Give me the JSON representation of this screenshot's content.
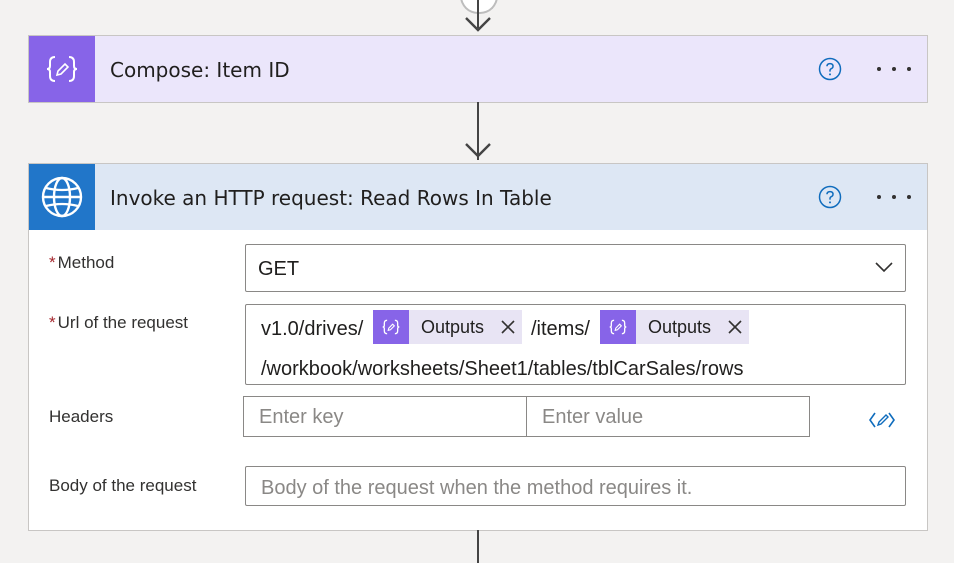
{
  "compose": {
    "title": "Compose: Item ID"
  },
  "http": {
    "title": "Invoke an HTTP request: Read Rows In Table",
    "required_marker": "*",
    "method": {
      "label": "Method",
      "value": "GET"
    },
    "url": {
      "label": "Url of the request",
      "seg1": "v1.0/drives/",
      "token1": "Outputs",
      "seg2": "/items/",
      "token2": "Outputs",
      "line2": "/workbook/worksheets/Sheet1/tables/tblCarSales/rows"
    },
    "headers": {
      "label": "Headers",
      "key_placeholder": "Enter key",
      "value_placeholder": "Enter value"
    },
    "body": {
      "label": "Body of the request",
      "placeholder": "Body of the request when the method requires it."
    }
  },
  "colors": {
    "compose_accent": "#8764e8",
    "compose_header_bg": "#ebe6fb",
    "http_accent": "#2176c9",
    "http_header_bg": "#dde7f4",
    "link_blue": "#0f6cbd"
  },
  "icons": {
    "compose": "braces-pencil-icon",
    "http": "globe-icon",
    "help": "question-circle-icon",
    "more": "ellipsis-icon",
    "dropdown": "chevron-down-icon",
    "remove": "close-icon",
    "switch_mode": "text-mode-icon",
    "arrow": "arrow-down-icon"
  }
}
